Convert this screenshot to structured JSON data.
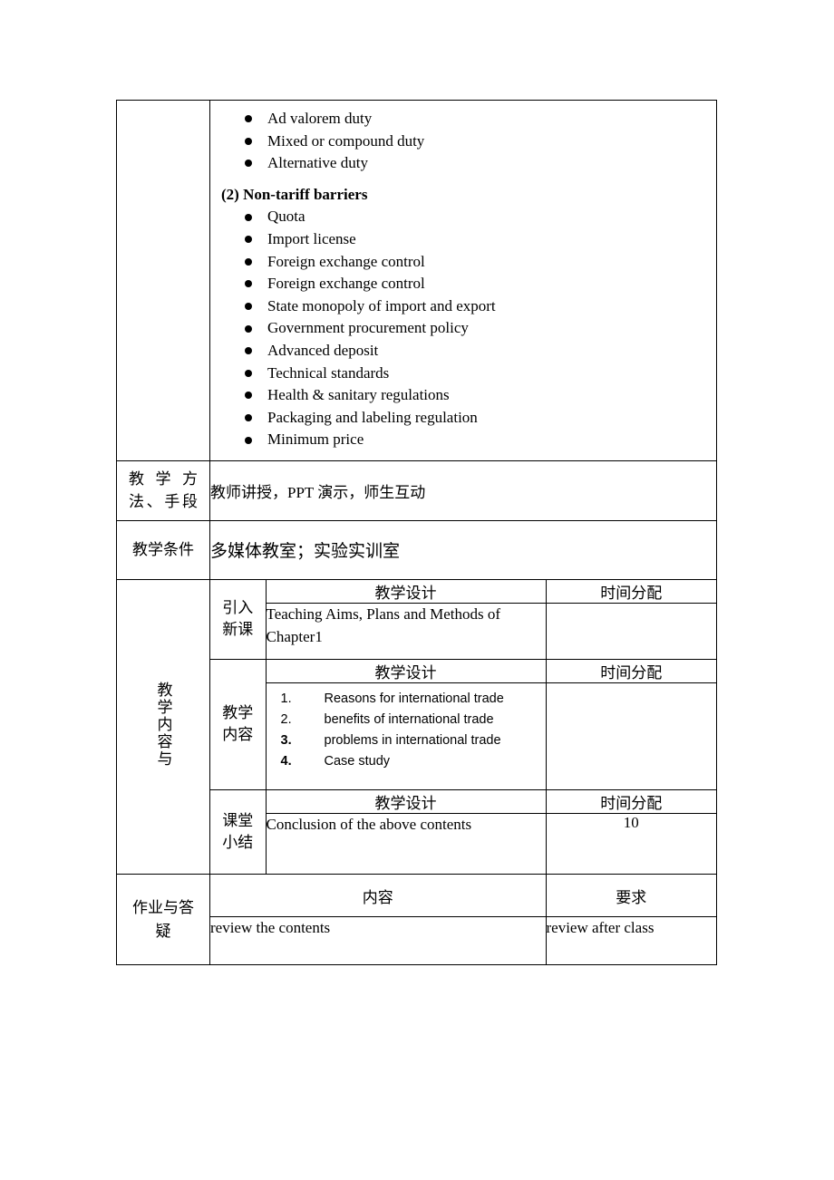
{
  "document": {
    "type": "lesson-plan-table",
    "language": "zh-CN/en"
  },
  "tariff_section": {
    "items_part1": [
      "Ad valorem duty",
      "Mixed or compound duty",
      "Alternative duty"
    ],
    "heading": "(2) Non-tariff barriers",
    "items_part2": [
      "Quota",
      "Import license",
      "Foreign exchange control",
      "Foreign exchange control",
      "State monopoly of import and export",
      "Government procurement policy",
      "Advanced deposit",
      "Technical standards",
      "Health & sanitary regulations",
      "Packaging and labeling regulation",
      "Minimum price"
    ]
  },
  "method_row": {
    "label": "教 学 方法、手段",
    "label_line1": "教 学 方",
    "label_line2": "法、手段",
    "value": "教师讲授，PPT 演示，师生互动"
  },
  "condition_row": {
    "label": "教学条件",
    "value": "多媒体教室；实验实训室"
  },
  "content_section": {
    "vertical_label": "教学内容与",
    "blocks": [
      {
        "sub_label_line1": "引入",
        "sub_label_line2": "新课",
        "header_design": "教学设计",
        "header_time": "时间分配",
        "body_text": "Teaching Aims, Plans and Methods of Chapter1",
        "time_value": ""
      },
      {
        "sub_label_line1": "教学",
        "sub_label_line2": "内容",
        "header_design": "教学设计",
        "header_time": "时间分配",
        "numbered_items": [
          {
            "num": "1.",
            "text": "Reasons for international trade",
            "bold": false
          },
          {
            "num": "2.",
            "text": "benefits of international trade",
            "bold": false
          },
          {
            "num": "3.",
            "text": "problems in international trade",
            "bold": true
          },
          {
            "num": "4.",
            "text": "Case study",
            "bold": true
          }
        ],
        "time_value": ""
      },
      {
        "sub_label_line1": "课堂",
        "sub_label_line2": "小结",
        "header_design": "教学设计",
        "header_time": "时间分配",
        "body_text": "Conclusion of the above contents",
        "time_value": "10"
      }
    ]
  },
  "homework_section": {
    "label_line1": "作业与答",
    "label_line2": "疑",
    "header_content": "内容",
    "header_requirement": "要求",
    "content_value": "review the contents",
    "requirement_value": "review after class"
  },
  "colors": {
    "border": "#000000",
    "text": "#000000",
    "background": "#ffffff"
  }
}
